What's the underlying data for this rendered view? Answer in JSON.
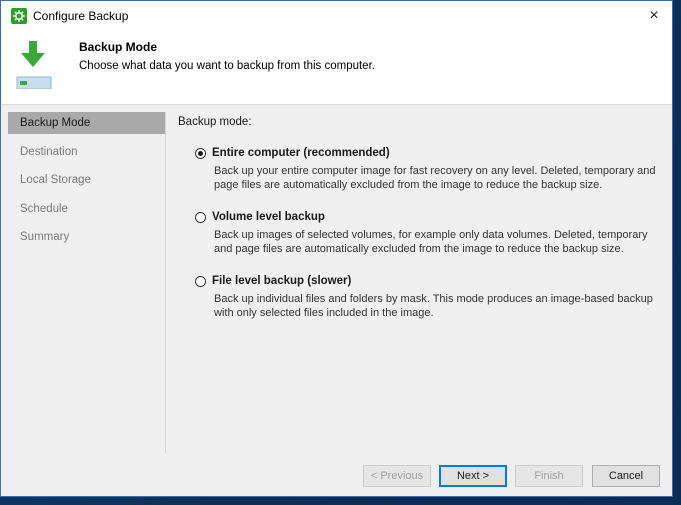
{
  "window": {
    "title": "Configure Backup",
    "close_symbol": "×"
  },
  "header": {
    "title": "Backup Mode",
    "subtitle": "Choose what data you want to backup from this computer."
  },
  "sidebar": {
    "items": [
      {
        "label": "Backup Mode",
        "active": true
      },
      {
        "label": "Destination",
        "active": false
      },
      {
        "label": "Local Storage",
        "active": false
      },
      {
        "label": "Schedule",
        "active": false
      },
      {
        "label": "Summary",
        "active": false
      }
    ]
  },
  "main": {
    "section_label": "Backup mode:",
    "options": [
      {
        "title": "Entire computer (recommended)",
        "description": "Back up your entire computer image for fast recovery on any level. Deleted, temporary and page files are automatically excluded from the image to reduce the backup size.",
        "selected": true
      },
      {
        "title": "Volume level backup",
        "description": "Back up images of selected volumes, for example only data volumes. Deleted, temporary and page files are automatically excluded from the image to reduce the backup size.",
        "selected": false
      },
      {
        "title": "File level backup (slower)",
        "description": "Back up individual files and folders by mask. This mode produces an image-based backup with only selected files included in the image.",
        "selected": false
      }
    ]
  },
  "footer": {
    "previous_label": "< Previous",
    "next_label": "Next >",
    "finish_label": "Finish",
    "cancel_label": "Cancel"
  },
  "colors": {
    "accent": "#0078d7",
    "icon_green": "#2c9f2c",
    "sidebar_active": "#a9a9a9",
    "desktop": "#0d3b6e"
  }
}
